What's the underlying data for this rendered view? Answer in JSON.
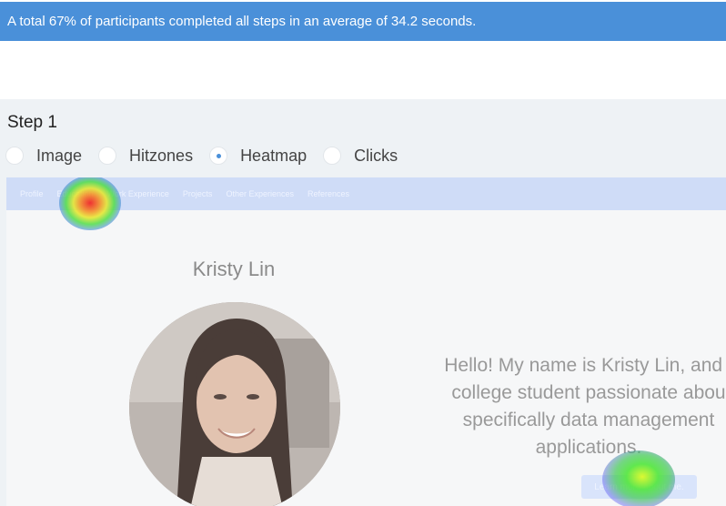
{
  "banner": {
    "text": "A total 67% of participants completed all steps in an average of 34.2 seconds."
  },
  "step": {
    "title": "Step 1"
  },
  "modes": [
    {
      "label": "Image",
      "selected": false
    },
    {
      "label": "Hitzones",
      "selected": false
    },
    {
      "label": "Heatmap",
      "selected": true
    },
    {
      "label": "Clicks",
      "selected": false
    }
  ],
  "preview": {
    "nav": [
      "Profile",
      "Education",
      "Work Experience",
      "Projects",
      "Other Experiences",
      "References"
    ],
    "name": "Kristy Lin",
    "intro_lines": [
      "Hello! My name is Kristy Lin, and I",
      "college student passionate abou",
      "specifically data management",
      "applications."
    ],
    "button_label": "Learn more about me."
  },
  "colors": {
    "banner": "#4a90d9",
    "panel": "#eef2f5",
    "accent": "#4a90d9"
  }
}
